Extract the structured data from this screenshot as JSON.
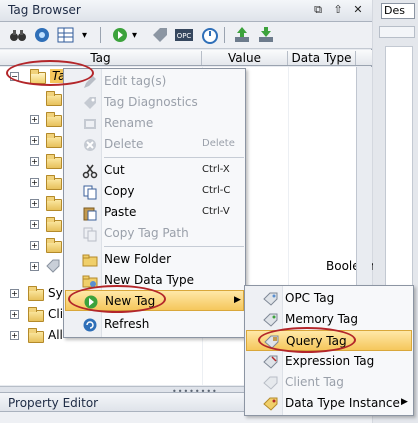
{
  "window": {
    "title": "Tag Browser",
    "ctrl_restore": "⧉",
    "ctrl_pin": "⇧",
    "ctrl_close": "✕"
  },
  "columns": {
    "tag": "Tag",
    "value": "Value",
    "data_type": "Data Type"
  },
  "tree": {
    "root_label": "Ta",
    "row_datatype": "Boolean",
    "bottom_items": [
      {
        "label": "Sys"
      },
      {
        "label": "Cli"
      },
      {
        "label": "All"
      }
    ]
  },
  "context_menu": {
    "items": [
      {
        "label": "Edit tag(s)",
        "disabled": true
      },
      {
        "label": "Tag Diagnostics",
        "disabled": true
      },
      {
        "label": "Rename",
        "disabled": true
      },
      {
        "label": "Delete",
        "shortcut": "Delete",
        "disabled": true
      },
      {
        "label": "Cut",
        "shortcut": "Ctrl-X"
      },
      {
        "label": "Copy",
        "shortcut": "Ctrl-C"
      },
      {
        "label": "Paste",
        "shortcut": "Ctrl-V"
      },
      {
        "label": "Copy Tag Path",
        "disabled": true
      },
      {
        "label": "New Folder"
      },
      {
        "label": "New Data Type"
      },
      {
        "label": "New Tag"
      },
      {
        "label": "Refresh"
      }
    ]
  },
  "submenu": {
    "items": [
      {
        "label": "OPC Tag"
      },
      {
        "label": "Memory Tag"
      },
      {
        "label": "Query Tag"
      },
      {
        "label": "Expression Tag"
      },
      {
        "label": "Client Tag",
        "disabled": true
      },
      {
        "label": "Data Type Instance"
      }
    ]
  },
  "property_editor": {
    "title": "Property Editor"
  },
  "right_pane": {
    "dropdown_text": "Des"
  },
  "colors": {
    "highlight": "#f5c75c",
    "annotation_ring": "#b3262a"
  }
}
